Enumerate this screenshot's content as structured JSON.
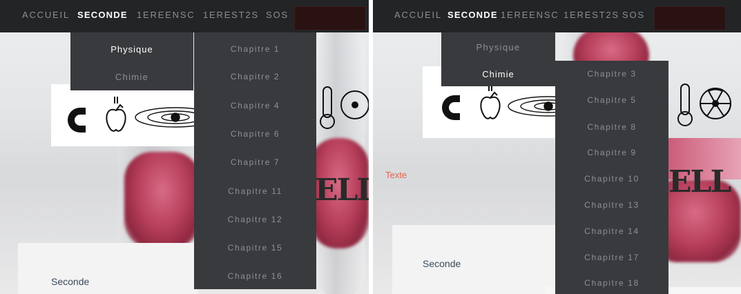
{
  "nav": {
    "items": [
      "ACCUEIL",
      "SECONDE",
      "1EREENSC",
      "1EREST2S",
      "SOS"
    ],
    "active": "SECONDE"
  },
  "left": {
    "submenu": {
      "items": [
        "Physique",
        "Chimie"
      ],
      "active": "Physique"
    },
    "chapters": [
      "Chapitre 1",
      "Chapitre 2",
      "Chapitre 4",
      "Chapitre 6",
      "Chapitre 7",
      "Chapitre 11",
      "Chapitre 12",
      "Chapitre 15",
      "Chapitre 16"
    ],
    "section_label": "Seconde"
  },
  "right": {
    "submenu": {
      "items": [
        "Physique",
        "Chimie"
      ],
      "active": "Chimie"
    },
    "chapters": [
      "Chapitre 3",
      "Chapitre 5",
      "Chapitre 8",
      "Chapitre 9",
      "Chapitre 10",
      "Chapitre 13",
      "Chapitre 14",
      "Chapitre 17",
      "Chapitre 18"
    ],
    "texte_label": "Texte",
    "section_label": "Seconde"
  },
  "icons": [
    "magnet-icon",
    "apple-icon",
    "orbit-icon",
    "thermometer-icon",
    "radioactive-icon"
  ],
  "colors": {
    "navbar": "#222426",
    "dropdown": "#383a3d",
    "accent_text": "#e8634f"
  }
}
